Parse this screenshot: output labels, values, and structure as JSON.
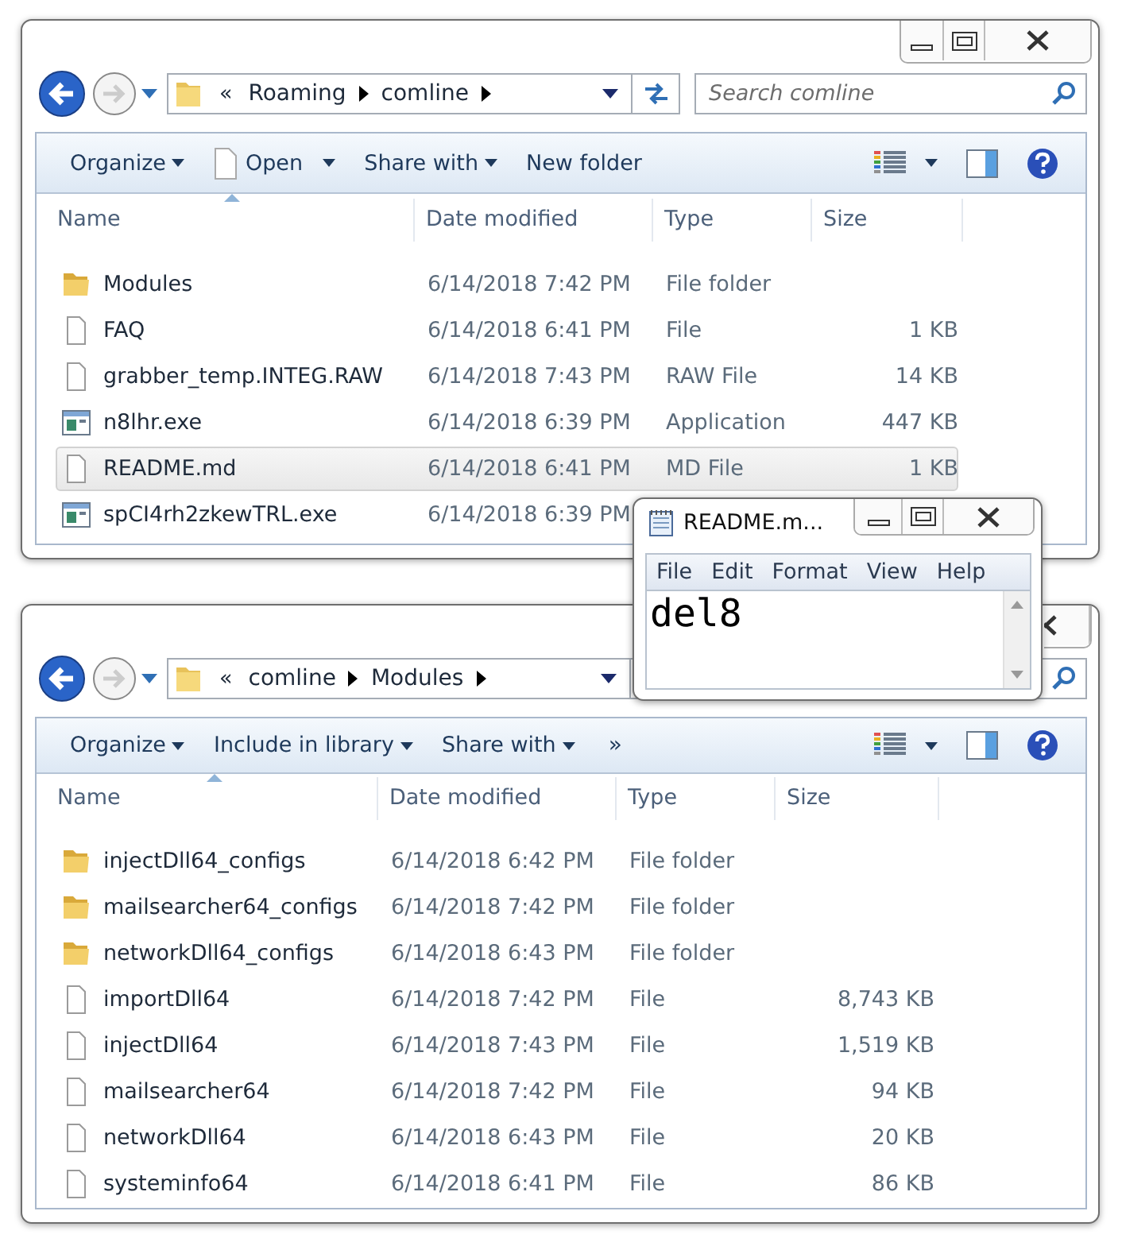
{
  "windows": [
    {
      "path_mark": "«",
      "address": [
        "Roaming",
        "comline"
      ],
      "search": {
        "placeholder": "Search comline"
      },
      "toolbar": [
        {
          "label": "Organize",
          "kind": "menu"
        },
        {
          "label": "Open",
          "kind": "file-menu"
        },
        {
          "label": "Share with",
          "kind": "menu"
        },
        {
          "label": "New folder",
          "kind": "button"
        }
      ],
      "columns": [
        "Name",
        "Date modified",
        "Type",
        "Size"
      ],
      "rows": [
        {
          "kind": "folder",
          "name": "Modules",
          "date": "6/14/2018 7:42 PM",
          "type": "File folder",
          "selected": false
        },
        {
          "kind": "file",
          "name": "FAQ",
          "date": "6/14/2018 6:41 PM",
          "type": "File",
          "size": "1 KB",
          "selected": false
        },
        {
          "kind": "file",
          "name": "grabber_temp.INTEG.RAW",
          "date": "6/14/2018 7:43 PM",
          "type": "RAW File",
          "size": "14 KB",
          "selected": false
        },
        {
          "kind": "app",
          "name": "n8lhr.exe",
          "date": "6/14/2018 6:39 PM",
          "type": "Application",
          "size": "447 KB",
          "selected": false
        },
        {
          "kind": "file",
          "name": "README.md",
          "date": "6/14/2018 6:41 PM",
          "type": "MD File",
          "size": "1 KB",
          "selected": true
        },
        {
          "kind": "app",
          "name": "spCI4rh2zkewTRL.exe",
          "date": "6/14/2018 6:39 PM",
          "selected": false
        }
      ]
    },
    {
      "path_mark": "«",
      "address": [
        "comline",
        "Modules"
      ],
      "toolbar": [
        {
          "label": "Organize",
          "kind": "menu"
        },
        {
          "label": "Include in library",
          "kind": "menu"
        },
        {
          "label": "Share with",
          "kind": "menu"
        },
        {
          "label": "»",
          "kind": "more"
        }
      ],
      "columns": [
        "Name",
        "Date modified",
        "Type",
        "Size"
      ],
      "rows": [
        {
          "kind": "folder",
          "name": "injectDll64_configs",
          "date": "6/14/2018 6:42 PM",
          "type": "File folder",
          "selected": false
        },
        {
          "kind": "folder",
          "name": "mailsearcher64_configs",
          "date": "6/14/2018 7:42 PM",
          "type": "File folder",
          "selected": false
        },
        {
          "kind": "folder",
          "name": "networkDll64_configs",
          "date": "6/14/2018 6:43 PM",
          "type": "File folder",
          "selected": false
        },
        {
          "kind": "file",
          "name": "importDll64",
          "date": "6/14/2018 7:42 PM",
          "type": "File",
          "size": "8,743 KB",
          "selected": false
        },
        {
          "kind": "file",
          "name": "injectDll64",
          "date": "6/14/2018 7:43 PM",
          "type": "File",
          "size": "1,519 KB",
          "selected": false
        },
        {
          "kind": "file",
          "name": "mailsearcher64",
          "date": "6/14/2018 7:42 PM",
          "type": "File",
          "size": "94 KB",
          "selected": false
        },
        {
          "kind": "file",
          "name": "networkDll64",
          "date": "6/14/2018 6:43 PM",
          "type": "File",
          "size": "20 KB",
          "selected": false
        },
        {
          "kind": "file",
          "name": "systeminfo64",
          "date": "6/14/2018 6:41 PM",
          "type": "File",
          "size": "86 KB",
          "selected": false
        }
      ]
    }
  ],
  "notepad": {
    "title": "README.m...",
    "menu": [
      "File",
      "Edit",
      "Format",
      "View",
      "Help"
    ],
    "text": "del8"
  }
}
